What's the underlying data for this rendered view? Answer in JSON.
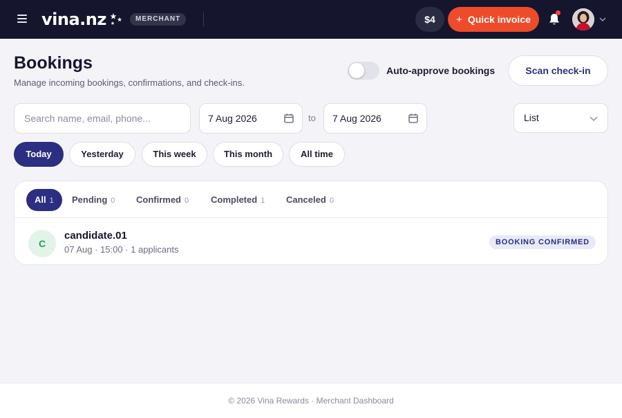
{
  "topbar": {
    "logo_text": "vina.nz",
    "badge": "MERCHANT",
    "balance": "$4",
    "quick_invoice_label": "Quick invoice",
    "quick_invoice_plus": "+",
    "accent_color": "#ee4b2b",
    "bar_color": "#15152e"
  },
  "header": {
    "title": "Bookings",
    "subtitle": "Manage incoming bookings, confirmations, and check-ins.",
    "auto_approve_label": "Auto-approve bookings",
    "auto_approve_on": false,
    "scan_label": "Scan check-in"
  },
  "filters": {
    "search_placeholder": "Search name, email, phone...",
    "date_from": "7 Aug 2026",
    "date_to": "7 Aug 2026",
    "to_label": "to",
    "view": "List",
    "periods": [
      "Today",
      "Yesterday",
      "This week",
      "This month",
      "All time"
    ],
    "active_period": "Today"
  },
  "tabs": [
    {
      "label": "All",
      "count": "1",
      "active": true
    },
    {
      "label": "Pending",
      "count": "0",
      "active": false
    },
    {
      "label": "Confirmed",
      "count": "0",
      "active": false
    },
    {
      "label": "Completed",
      "count": "1",
      "active": false
    },
    {
      "label": "Canceled",
      "count": "0",
      "active": false
    }
  ],
  "bookings": [
    {
      "initial": "C",
      "name": "candidate.01",
      "meta": "07 Aug · 15:00 · 1 applicants",
      "status": "BOOKING CONFIRMED"
    }
  ],
  "footer": {
    "text": "© 2026 Vina Rewards · Merchant Dashboard"
  }
}
